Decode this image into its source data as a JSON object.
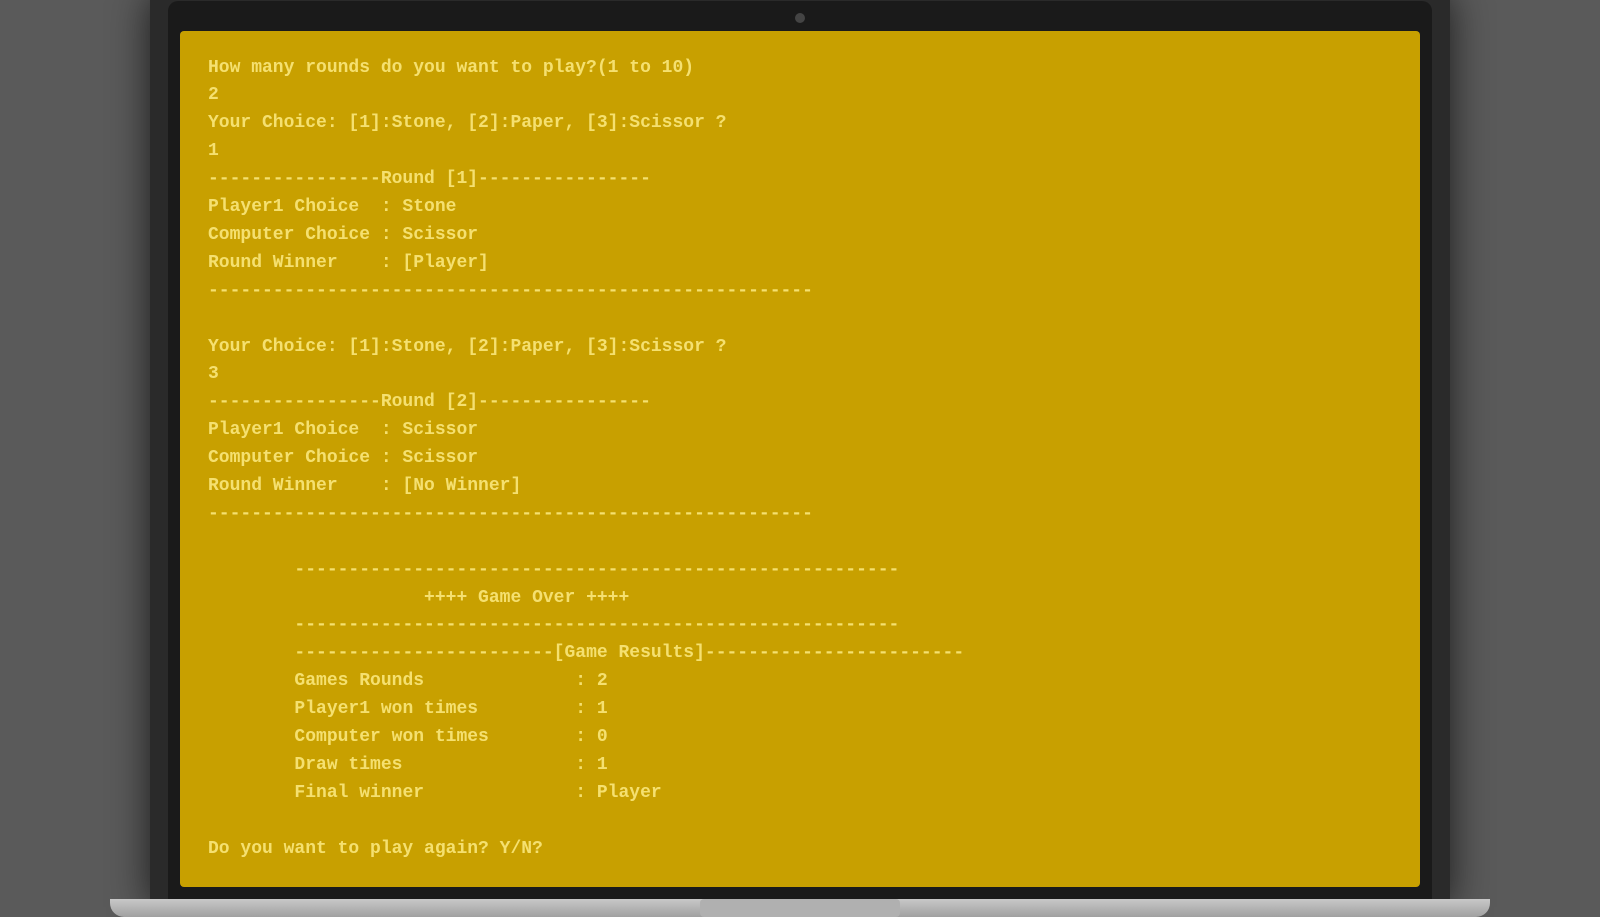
{
  "terminal": {
    "lines": [
      "How many rounds do you want to play?(1 to 10)",
      "2",
      "Your Choice: [1]:Stone, [2]:Paper, [3]:Scissor ?",
      "1",
      "----------------Round [1]----------------",
      "Player1 Choice  : Stone",
      "Computer Choice : Scissor",
      "Round Winner    : [Player]",
      "--------------------------------------------------------",
      "",
      "Your Choice: [1]:Stone, [2]:Paper, [3]:Scissor ?",
      "3",
      "----------------Round [2]----------------",
      "Player1 Choice  : Scissor",
      "Computer Choice : Scissor",
      "Round Winner    : [No Winner]",
      "--------------------------------------------------------",
      "",
      "        --------------------------------------------------------",
      "                    ++++ Game Over ++++",
      "        --------------------------------------------------------",
      "        ------------------------[Game Results]------------------------",
      "        Games Rounds              : 2",
      "        Player1 won times         : 1",
      "        Computer won times        : 0",
      "        Draw times                : 1",
      "        Final winner              : Player",
      "",
      "Do you want to play again? Y/N?"
    ]
  }
}
